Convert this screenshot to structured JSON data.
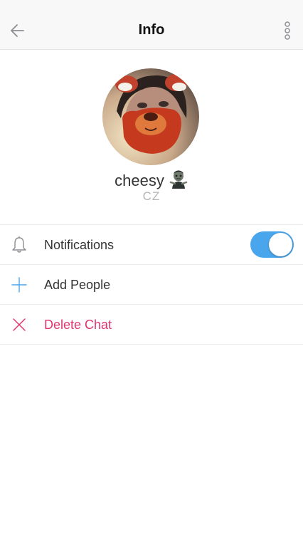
{
  "nav": {
    "title": "Info",
    "back_icon": "back-arrow-icon",
    "more_icon": "more-vertical-icon"
  },
  "profile": {
    "display_name": "cheesy",
    "name_emoji_icon": "zombie-emoji-icon",
    "username": "CZ"
  },
  "options": [
    {
      "label": "Notifications",
      "icon": "bell-icon",
      "toggle_on": true
    },
    {
      "label": "Add People",
      "icon": "plus-icon"
    },
    {
      "label": "Delete Chat",
      "icon": "close-icon"
    }
  ],
  "colors": {
    "accent": "#4aa6ec",
    "danger": "#e0356f",
    "secondary_text": "#b5b5b5"
  }
}
